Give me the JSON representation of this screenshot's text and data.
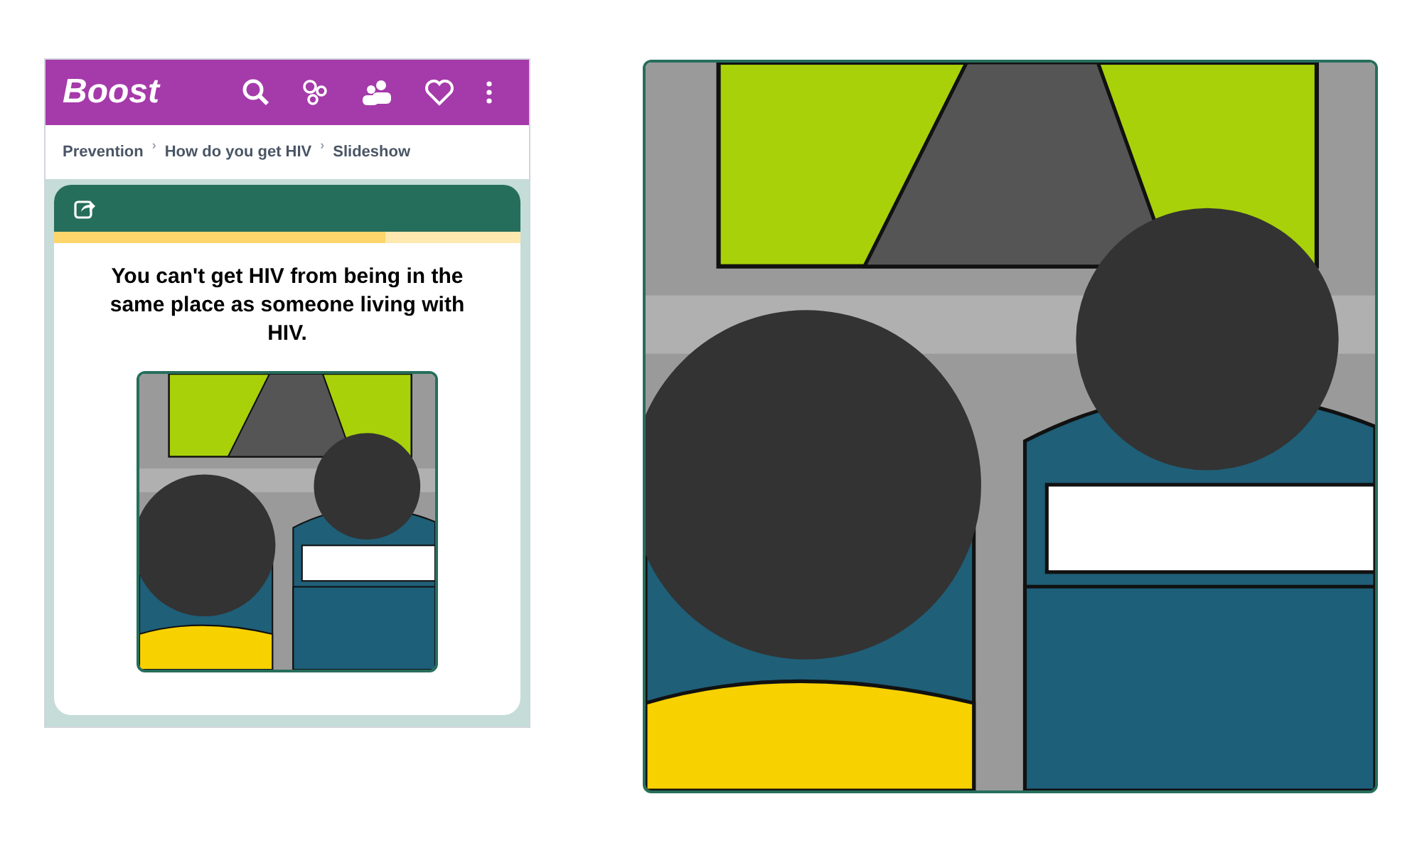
{
  "app_bar": {
    "logo": "Boost"
  },
  "breadcrumbs": [
    {
      "label": "Prevention"
    },
    {
      "label": "How do you get HIV"
    },
    {
      "label": "Slideshow"
    }
  ],
  "breadcrumb_separator": "›",
  "slide": {
    "progress": {
      "level": 0.71
    },
    "title": "You can't get HIV from being in the same place as someone living with HIV."
  }
}
